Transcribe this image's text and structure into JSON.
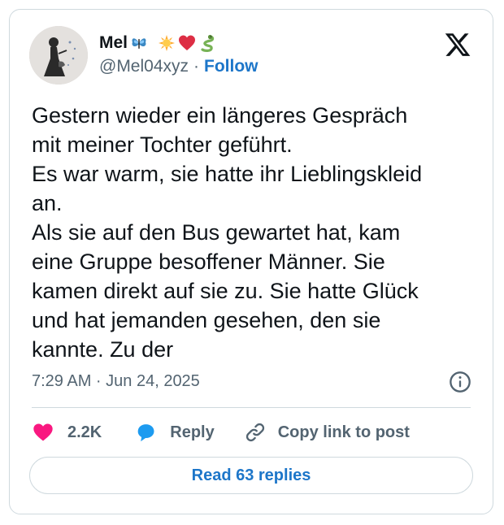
{
  "author": {
    "display_name": "Mel",
    "name_emojis": [
      "butterfly-icon",
      "sun-icon",
      "heart-icon",
      "snake-icon"
    ],
    "handle": "@Mel04xyz",
    "separator": "·",
    "follow_label": "Follow"
  },
  "tweet": {
    "text": "Gestern wieder ein längeres Gespräch\nmit meiner Tochter geführt.\nEs war warm, sie hatte ihr Lieblingskleid\nan.\nAls sie auf den Bus gewartet hat, kam\neine Gruppe besoffener Männer. Sie\nkamen direkt auf sie zu. Sie hatte Glück\nund hat jemanden gesehen, den sie\nkannte. Zu der",
    "timestamp": "7:29 AM · Jun 24, 2025"
  },
  "actions": {
    "like_count": "2.2K",
    "reply_label": "Reply",
    "copy_label": "Copy link to post"
  },
  "footer": {
    "read_replies_label": "Read 63 replies"
  },
  "colors": {
    "accent": "#1d76c9",
    "like": "#f91880",
    "reply_icon": "#1d9bf0",
    "text": "#0f1419",
    "muted": "#536471",
    "border": "#cfd9de"
  }
}
